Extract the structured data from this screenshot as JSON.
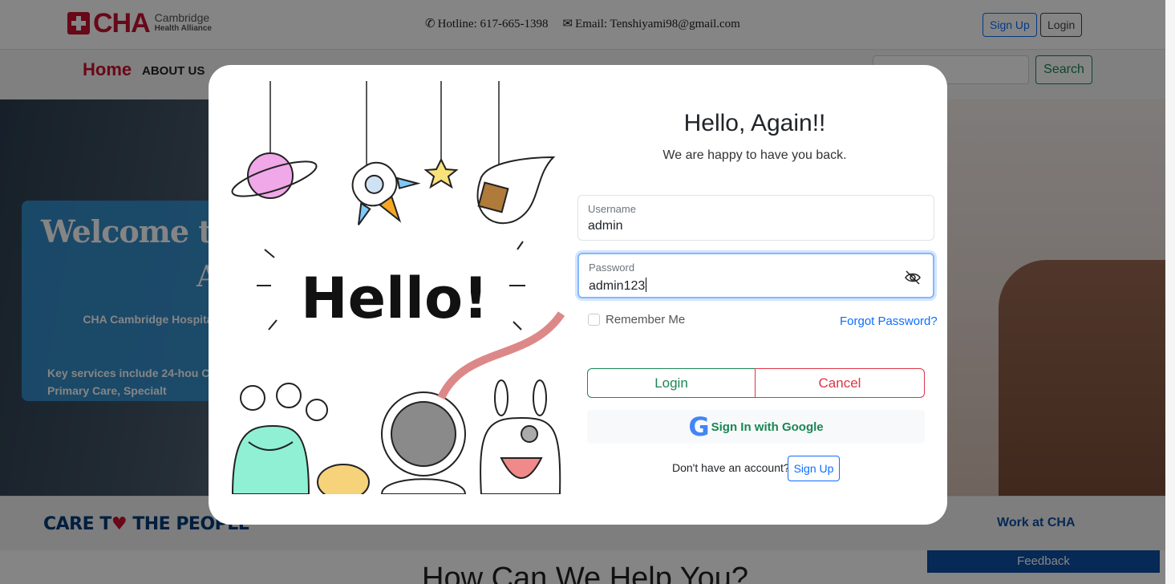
{
  "header": {
    "logo_text": "CHA",
    "logo_sub_1": "Cambridge",
    "logo_sub_2": "Health Alliance",
    "hotline": "Hotline: 617-665-1398",
    "email": "Email: Tenshiyami98@gmail.com",
    "signup_label": "Sign Up",
    "login_label": "Login"
  },
  "nav": {
    "home": "Home",
    "about": "ABOUT US",
    "search_button": "Search"
  },
  "hero": {
    "welcome": "Welcome to",
    "welcome_line2": "A",
    "text1": "CHA Cambridge Hospita comm",
    "text2": "Key services include 24-hou Care, Primary Care, Specialt"
  },
  "strip": {
    "care_prefix": "CARE T",
    "care_suffix": " THE PEOPLE",
    "work": "Work at CHA"
  },
  "feedback": "Feedback",
  "how_can": "How Can We Help You?",
  "modal": {
    "illustration_text": "Hello!",
    "title": "Hello, Again!!",
    "subtitle": "We are happy to have you back.",
    "username_label": "Username",
    "username_value": "admin",
    "password_label": "Password",
    "password_value": "admin123",
    "remember_label": "Remember Me",
    "forgot_label": "Forgot Password?",
    "login_button": "Login",
    "cancel_button": "Cancel",
    "google_button": "Sign In with Google",
    "no_account": "Don't have an account?",
    "signup_button": "Sign Up"
  },
  "colors": {
    "brand_red": "#c8102e",
    "success": "#198754",
    "danger": "#dc3545",
    "primary": "#0d6efd"
  }
}
